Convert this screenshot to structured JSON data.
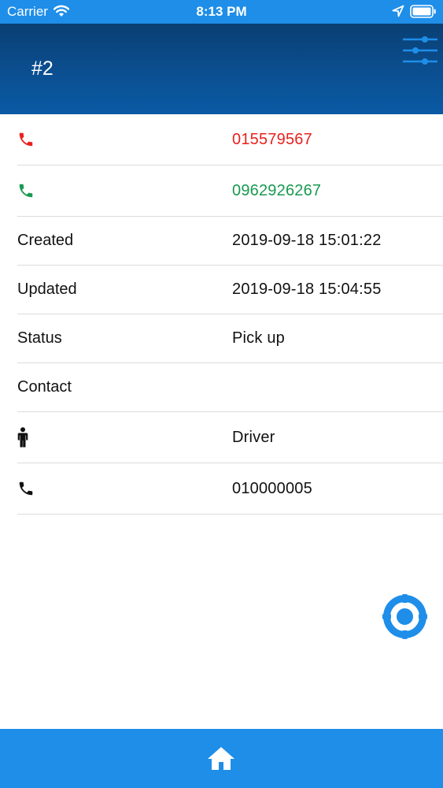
{
  "status_bar": {
    "carrier": "Carrier",
    "time": "8:13 PM",
    "icons": [
      "wifi-icon",
      "location-arrow-icon",
      "battery-icon"
    ]
  },
  "header": {
    "title": "#2",
    "background_color": "#0b4f91",
    "filter_icon": "sliders-icon"
  },
  "details": {
    "phone_1": {
      "icon": "phone-icon",
      "icon_color": "#e8211e",
      "value": "015579567"
    },
    "phone_2": {
      "icon": "phone-icon",
      "icon_color": "#179a50",
      "value": "0962926267"
    },
    "created": {
      "label": "Created",
      "value": "2019-09-18 15:01:22"
    },
    "updated": {
      "label": "Updated",
      "value": "2019-09-18 15:04:55"
    },
    "status": {
      "label": "Status",
      "value": "Pick up"
    },
    "contact": {
      "label": "Contact"
    },
    "person": {
      "icon": "person-icon",
      "value": "Driver"
    },
    "person_phone": {
      "icon": "phone-icon",
      "value": "010000005"
    }
  },
  "locate_button": {
    "icon": "crosshair-icon",
    "color": "#1e8ee8"
  },
  "tab_bar": {
    "background_color": "#1e8ee8",
    "home_icon": "home-icon"
  }
}
